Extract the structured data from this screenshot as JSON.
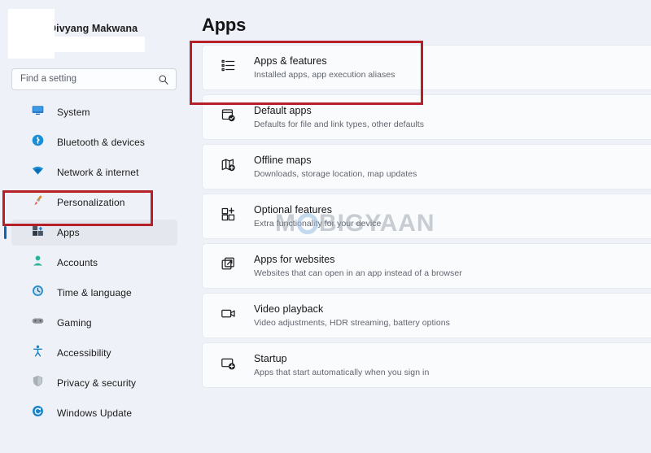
{
  "account": {
    "name": "Divyang Makwana",
    "avatar_redacted": true,
    "email_redacted": true
  },
  "search": {
    "placeholder": "Find a setting",
    "value": "",
    "icon": "search-icon"
  },
  "sidebar": {
    "items": [
      {
        "label": "System",
        "icon": "monitor-icon",
        "selected": false
      },
      {
        "label": "Bluetooth & devices",
        "icon": "bluetooth-icon",
        "selected": false
      },
      {
        "label": "Network & internet",
        "icon": "wifi-icon",
        "selected": false
      },
      {
        "label": "Personalization",
        "icon": "paintbrush-icon",
        "selected": false
      },
      {
        "label": "Apps",
        "icon": "apps-icon",
        "selected": true
      },
      {
        "label": "Accounts",
        "icon": "person-icon",
        "selected": false
      },
      {
        "label": "Time & language",
        "icon": "clock-globe-icon",
        "selected": false
      },
      {
        "label": "Gaming",
        "icon": "gamepad-icon",
        "selected": false
      },
      {
        "label": "Accessibility",
        "icon": "accessibility-icon",
        "selected": false
      },
      {
        "label": "Privacy & security",
        "icon": "shield-icon",
        "selected": false
      },
      {
        "label": "Windows Update",
        "icon": "update-icon",
        "selected": false
      }
    ]
  },
  "main": {
    "title": "Apps",
    "cards": [
      {
        "title": "Apps & features",
        "subtitle": "Installed apps, app execution aliases",
        "icon": "list-icon"
      },
      {
        "title": "Default apps",
        "subtitle": "Defaults for file and link types, other defaults",
        "icon": "default-apps-icon"
      },
      {
        "title": "Offline maps",
        "subtitle": "Downloads, storage location, map updates",
        "icon": "map-icon"
      },
      {
        "title": "Optional features",
        "subtitle": "Extra functionality for your device",
        "icon": "optional-features-icon"
      },
      {
        "title": "Apps for websites",
        "subtitle": "Websites that can open in an app instead of a browser",
        "icon": "external-link-icon"
      },
      {
        "title": "Video playback",
        "subtitle": "Video adjustments, HDR streaming, battery options",
        "icon": "video-icon"
      },
      {
        "title": "Startup",
        "subtitle": "Apps that start automatically when you sign in",
        "icon": "startup-icon"
      }
    ]
  },
  "watermark": {
    "text_before": "M",
    "text_after": "BIGYAAN"
  },
  "annotations": {
    "colors": {
      "highlight": "#b51f27",
      "accent": "#0d63b5"
    },
    "boxes": [
      {
        "name": "apps-nav-highlight",
        "target": "Apps"
      },
      {
        "name": "apps-features-highlight",
        "target": "Apps & features"
      }
    ]
  }
}
